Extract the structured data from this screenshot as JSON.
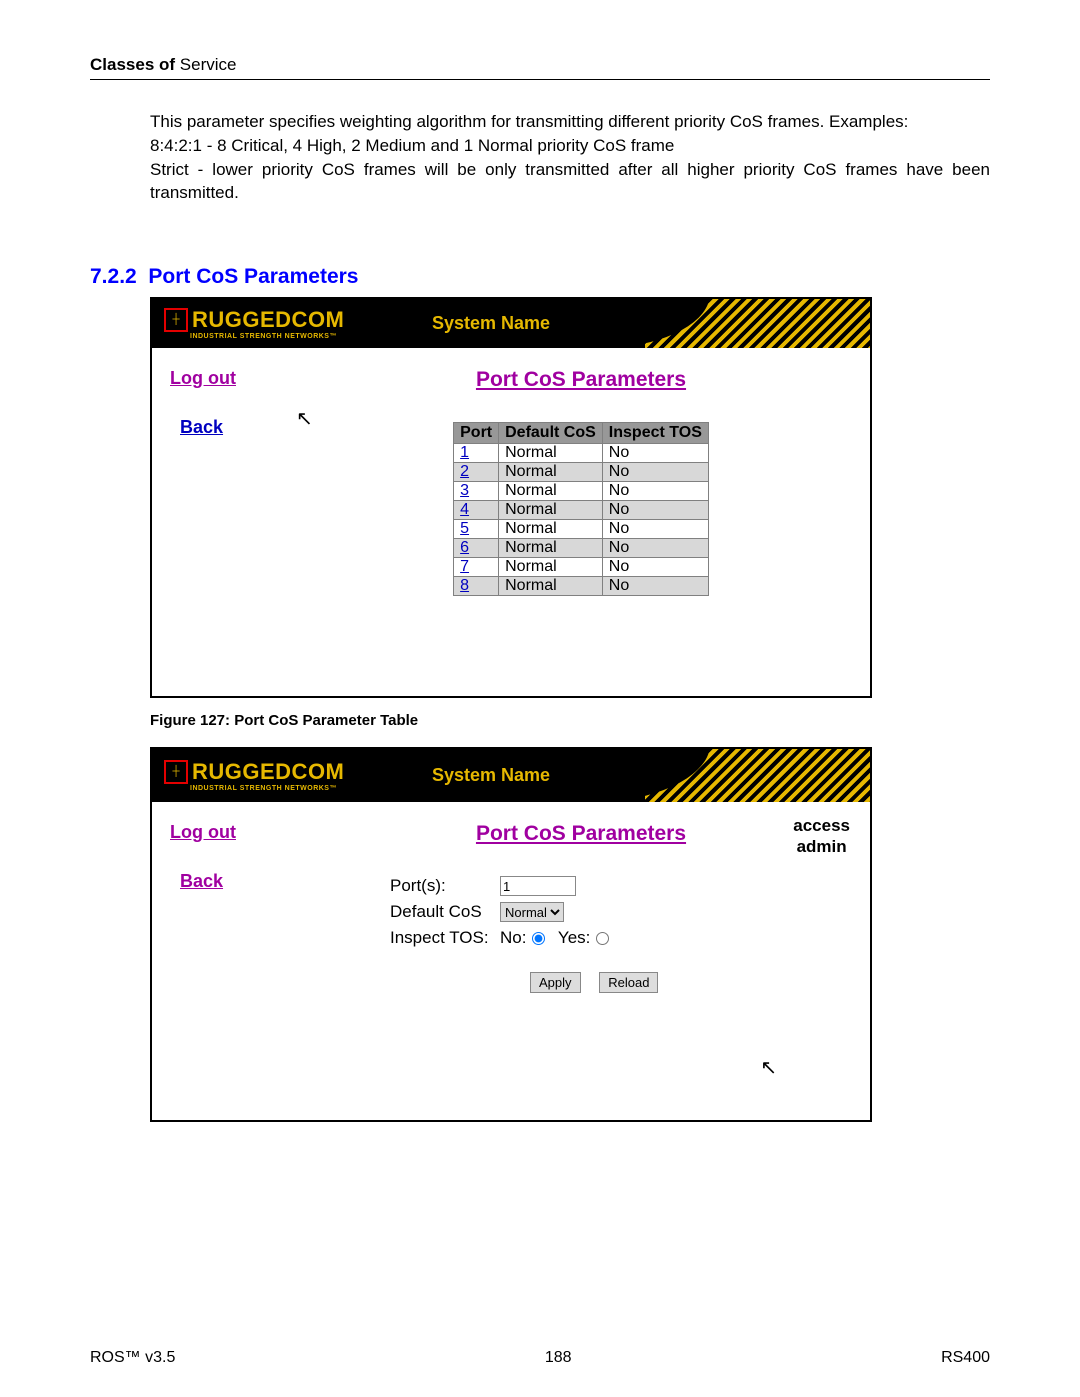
{
  "header": {
    "bold": "Classes of",
    "rest": " Service"
  },
  "intro": {
    "p1": "This parameter specifies weighting algorithm for transmitting different priority CoS frames. Examples:",
    "p2": "8:4:2:1  - 8 Critical, 4 High, 2 Medium and 1 Normal priority CoS frame",
    "p3": "Strict    - lower priority CoS frames will be only transmitted after all higher priority CoS frames have been transmitted."
  },
  "section": {
    "num": "7.2.2",
    "title": "Port CoS Parameters"
  },
  "banner": {
    "brand": "RUGGEDCOM",
    "tagline": "INDUSTRIAL STRENGTH NETWORKS™",
    "sysname": "System Name"
  },
  "nav": {
    "logout": "Log out",
    "back": "Back"
  },
  "panel": {
    "title": "Port CoS Parameters"
  },
  "table": {
    "headers": {
      "port": "Port",
      "defcos": "Default CoS",
      "tos": "Inspect TOS"
    },
    "rows": [
      {
        "port": "1",
        "cos": "Normal",
        "tos": "No"
      },
      {
        "port": "2",
        "cos": "Normal",
        "tos": "No"
      },
      {
        "port": "3",
        "cos": "Normal",
        "tos": "No"
      },
      {
        "port": "4",
        "cos": "Normal",
        "tos": "No"
      },
      {
        "port": "5",
        "cos": "Normal",
        "tos": "No"
      },
      {
        "port": "6",
        "cos": "Normal",
        "tos": "No"
      },
      {
        "port": "7",
        "cos": "Normal",
        "tos": "No"
      },
      {
        "port": "8",
        "cos": "Normal",
        "tos": "No"
      }
    ]
  },
  "caption": "Figure 127: Port CoS Parameter Table",
  "access": {
    "line1": "access",
    "line2": "admin"
  },
  "form": {
    "ports_label": "Port(s):",
    "ports_value": "1",
    "defcos_label": "Default CoS",
    "defcos_value": "Normal",
    "tos_label": "Inspect TOS:",
    "no": "No:",
    "yes": "Yes:",
    "apply": "Apply",
    "reload": "Reload"
  },
  "footer": {
    "left": "ROS™  v3.5",
    "center": "188",
    "right": "RS400"
  }
}
